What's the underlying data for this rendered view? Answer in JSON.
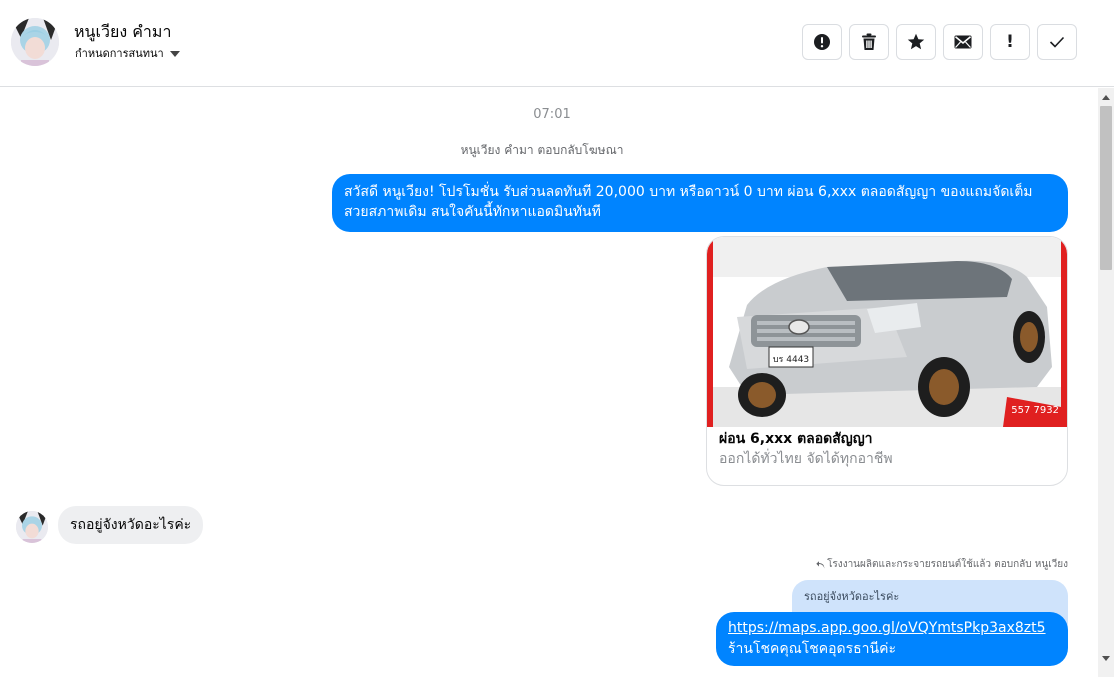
{
  "header": {
    "name": "หนูเวียง คำมา",
    "subtitle": "กำหนดการสนทนา",
    "actions": [
      {
        "icon": "alert-circle-icon",
        "label": ""
      },
      {
        "icon": "trash-icon",
        "label": ""
      },
      {
        "icon": "star-icon",
        "label": ""
      },
      {
        "icon": "envelope-icon",
        "label": ""
      },
      {
        "icon": "exclamation-icon",
        "label": "!"
      },
      {
        "icon": "checkmark-icon",
        "label": ""
      }
    ]
  },
  "conversation": {
    "time": "07:01",
    "notice": "หนูเวียง คำมา ตอบกลับโฆษณา",
    "ad_message": "สวัสดี หนูเวียง! โปรโมชั่น รับส่วนลดทันที 20,000 บาท หรือดาวน์ 0 บาท ผ่อน 6,xxx ตลอดสัญญา ของแถมจัดเต็ม สวยสภาพเดิม สนใจคันนี้ทักหาแอดมินทันที",
    "card": {
      "title": "ผ่อน 6,xxx ตลอดสัญญา",
      "subtitle": "ออกได้ทั่วไทย จัดได้ทุกอาชีพ",
      "plate": "บร 4443",
      "phone_fragment": "557 7932"
    },
    "customer_message": "รถอยู่จังหวัดอะไรค่ะ",
    "reply_label": "โรงงานผลิตและกระจายรถยนต์ใช้แล้ว ตอบกลับ หนูเวียง",
    "quoted_text": "รถอยู่จังหวัดอะไรค่ะ",
    "reply_link": "https://maps.app.goo.gl/oVQYmtsPkp3ax8zt5",
    "reply_text": "ร้านโชคคุณโชคอุดรธานีค่ะ"
  },
  "colors": {
    "outgoing_bubble": "#0084ff",
    "incoming_bubble": "#eeeff1",
    "quoted_bubble": "#cfe3fb"
  }
}
